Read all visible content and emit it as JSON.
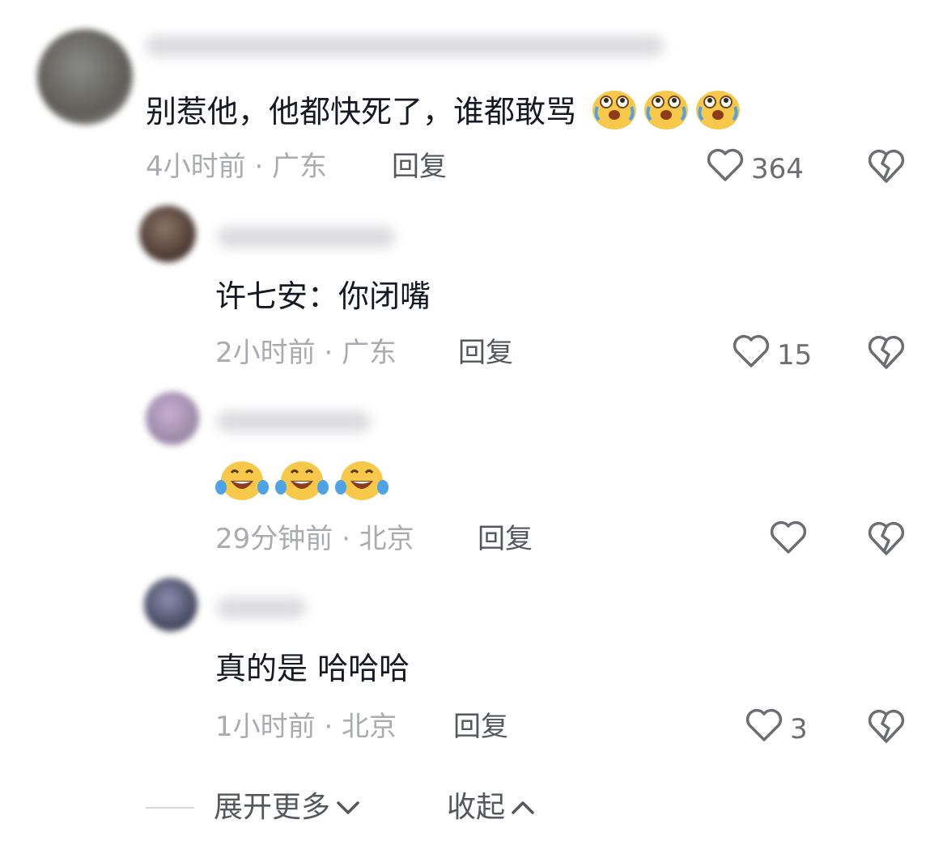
{
  "comments": [
    {
      "text": "别惹他，他都快死了，谁都敢骂",
      "emoji": [
        "crying-face",
        "crying-face",
        "crying-face"
      ],
      "time": "4小时前 · 广东",
      "reply": "回复",
      "likes": "364"
    },
    {
      "text": "许七安：你闭嘴",
      "time": "2小时前 · 广东",
      "reply": "回复",
      "likes": "15"
    },
    {
      "text": "",
      "emoji": [
        "laughing-face",
        "laughing-face",
        "laughing-face"
      ],
      "time": "29分钟前 · 北京",
      "reply": "回复",
      "likes": ""
    },
    {
      "text": "真的是 哈哈哈",
      "time": "1小时前 · 北京",
      "reply": "回复",
      "likes": "3"
    }
  ],
  "footer": {
    "expand": "展开更多",
    "collapse": "收起"
  }
}
